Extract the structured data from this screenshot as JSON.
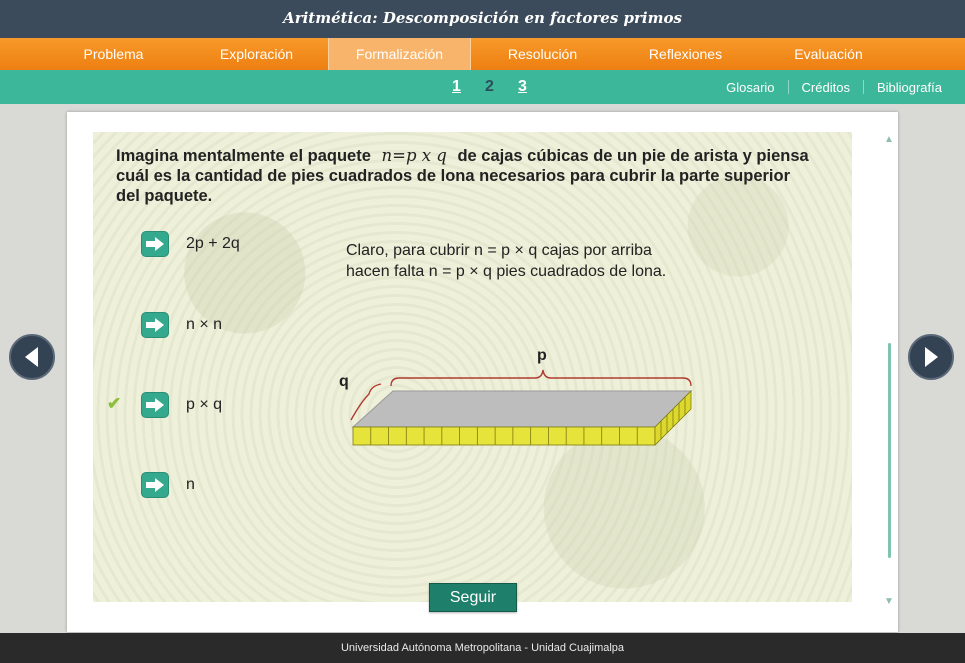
{
  "app": {
    "title": "Aritmética: Descomposición en factores primos"
  },
  "nav": {
    "items": [
      {
        "label": "Problema"
      },
      {
        "label": "Exploración"
      },
      {
        "label": "Formalización"
      },
      {
        "label": "Resolución"
      },
      {
        "label": "Reflexiones"
      },
      {
        "label": "Evaluación"
      }
    ],
    "active": "Formalización"
  },
  "subnav": {
    "pages": [
      "1",
      "2",
      "3"
    ],
    "current_page": "2",
    "links": [
      "Glosario",
      "Créditos",
      "Bibliografía"
    ]
  },
  "question": {
    "text_before": "Imagina mentalmente el paquete",
    "formula": "n=p x q",
    "text_after": "de cajas cúbicas de un pie de arista y piensa cuál es la cantidad de pies cuadrados de lona necesarios para cubrir la parte superior del paquete."
  },
  "options": [
    {
      "label": "2p + 2q",
      "checked": false
    },
    {
      "label": "n × n",
      "checked": false
    },
    {
      "label": "p × q",
      "checked": true
    },
    {
      "label": "n",
      "checked": false
    }
  ],
  "check_icon": "✔",
  "explanation": {
    "line1": "Claro, para cubrir n = p × q cajas por arriba",
    "line2": "hacen falta n = p × q pies cuadrados de lona."
  },
  "diagram": {
    "label_p": "p",
    "label_q": "q",
    "boxes_along_p": 17,
    "boxes_along_q": 6
  },
  "continue_button": "Seguir",
  "footer": "Universidad Autónoma Metropolitana - Unidad Cuajimalpa",
  "colors": {
    "header": "#3c4b5b",
    "nav": "#ee7f12",
    "subnav": "#3db79a",
    "accent": "#34a98d",
    "box_face": "#e6e33a",
    "box_top": "#bdbdbd",
    "brace": "#b03a2e"
  }
}
